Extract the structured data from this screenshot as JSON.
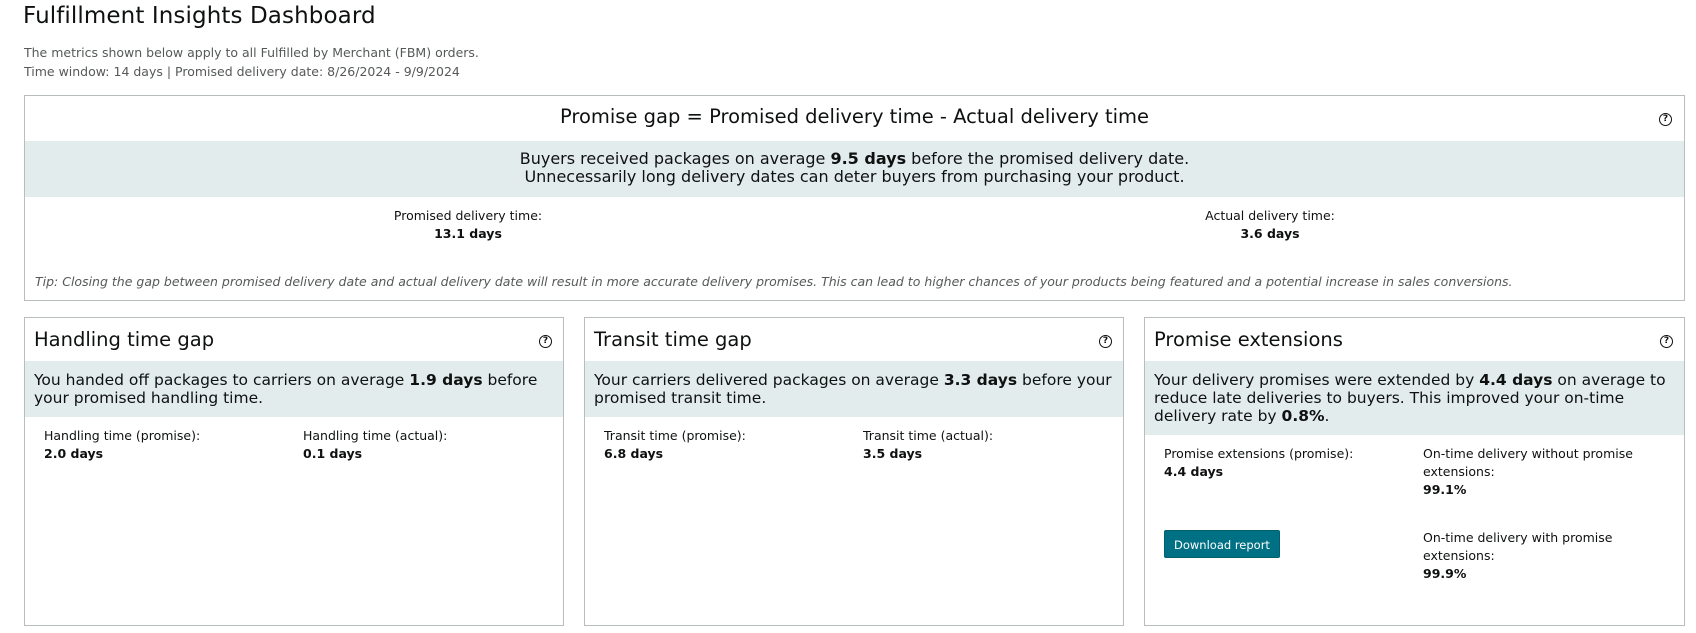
{
  "header": {
    "title": "Fulfillment Insights Dashboard",
    "subtitle_line1": "The metrics shown below apply to all Fulfilled by Merchant (FBM) orders.",
    "subtitle_line2": "Time window: 14 days | Promised delivery date: 8/26/2024 - 9/9/2024"
  },
  "promise_gap": {
    "title": "Promise gap = Promised delivery time - Actual delivery time",
    "summary_prefix": "Buyers received packages on average ",
    "summary_value": "9.5 days",
    "summary_suffix": " before the promised delivery date.",
    "summary_line2": "Unnecessarily long delivery dates can deter buyers from purchasing your product.",
    "promised_label": "Promised delivery time:",
    "promised_value": "13.1 days",
    "actual_label": "Actual delivery time:",
    "actual_value": "3.6 days",
    "tip": "Tip: Closing the gap between promised delivery date and actual delivery date will result in more accurate delivery promises. This can lead to higher chances of your products being featured and a potential increase in sales conversions."
  },
  "handling": {
    "title": "Handling time gap",
    "summary_prefix": "You handed off packages to carriers on average ",
    "summary_value": "1.9 days",
    "summary_suffix": " before your promised handling time.",
    "promise_label": "Handling time (promise):",
    "promise_value": "2.0 days",
    "actual_label": "Handling time (actual):",
    "actual_value": "0.1 days"
  },
  "transit": {
    "title": "Transit time gap",
    "summary_prefix": "Your carriers delivered packages on average ",
    "summary_value": "3.3 days",
    "summary_suffix": " before your promised transit time.",
    "promise_label": "Transit time (promise):",
    "promise_value": "6.8 days",
    "actual_label": "Transit time (actual):",
    "actual_value": "3.5 days"
  },
  "extensions": {
    "title": "Promise extensions",
    "summary_prefix": "Your delivery promises were extended by ",
    "summary_value": "4.4 days",
    "summary_middle": " on average to reduce late deliveries to buyers. This improved your on-time delivery rate by ",
    "summary_value2": "0.8%",
    "summary_suffix": ".",
    "promise_label": "Promise extensions (promise):",
    "promise_value": "4.4 days",
    "without_label": "On-time delivery without promise extensions:",
    "without_value": "99.1%",
    "with_label": "On-time delivery with promise extensions:",
    "with_value": "99.9%",
    "download_label": "Download report"
  },
  "icons": {
    "help": "?"
  },
  "colors": {
    "band": "#e3ecec",
    "button": "#007185",
    "border": "#b8bdbd",
    "subtext": "#565959"
  }
}
